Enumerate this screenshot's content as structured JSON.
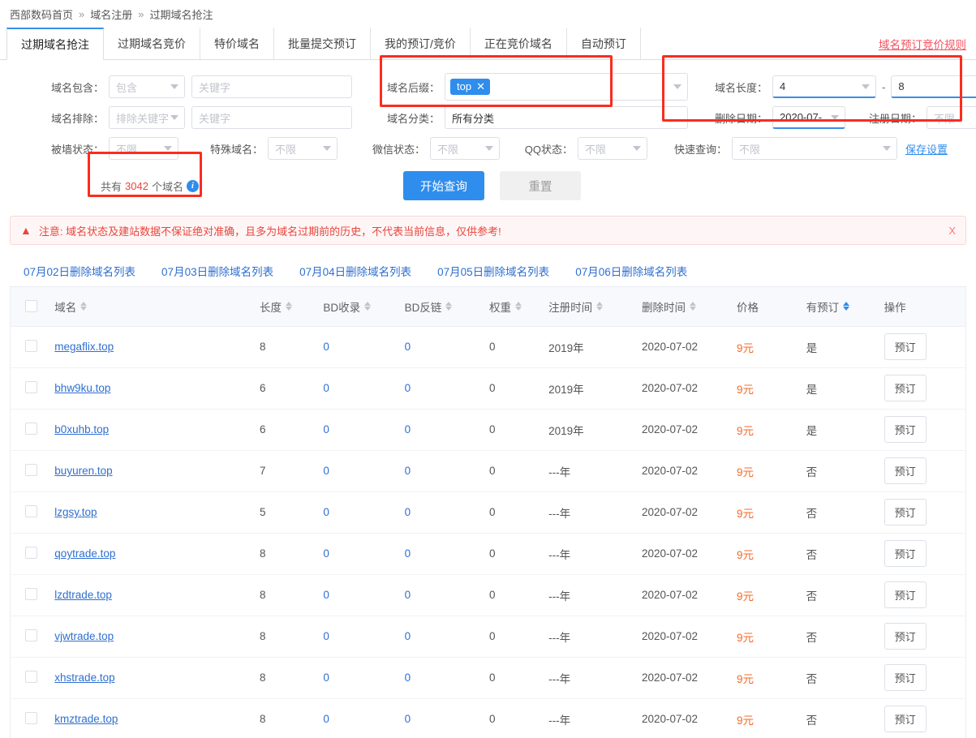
{
  "breadcrumb": {
    "items": [
      "西部数码首页",
      "域名注册",
      "过期域名抢注"
    ],
    "separator": "»"
  },
  "tabs": [
    {
      "label": "过期域名抢注",
      "active": true
    },
    {
      "label": "过期域名竞价",
      "active": false
    },
    {
      "label": "特价域名",
      "active": false
    },
    {
      "label": "批量提交预订",
      "active": false
    },
    {
      "label": "我的预订/竞价",
      "active": false
    },
    {
      "label": "正在竞价域名",
      "active": false
    },
    {
      "label": "自动预订",
      "active": false
    }
  ],
  "rules_link": "域名预订竞价规则",
  "filters": {
    "domain_contains": {
      "label": "域名包含：",
      "mode": "包含",
      "keyword_placeholder": "关键字",
      "keyword_value": ""
    },
    "domain_exclude": {
      "label": "域名排除：",
      "mode": "排除关键字",
      "keyword_placeholder": "关键字",
      "keyword_value": ""
    },
    "blocked_status": {
      "label": "被墙状态：",
      "value": "不限"
    },
    "special_domain": {
      "label": "特殊域名：",
      "value": "不限"
    },
    "domain_suffix": {
      "label": "域名后缀：",
      "tag": "top",
      "tag_close": "✕"
    },
    "domain_category": {
      "label": "域名分类：",
      "value": "所有分类"
    },
    "wechat_status": {
      "label": "微信状态：",
      "value": "不限"
    },
    "qq_status": {
      "label": "QQ状态：",
      "value": "不限"
    },
    "domain_length": {
      "label": "域名长度：",
      "from": "4",
      "separator": "-",
      "to": "8"
    },
    "delete_date": {
      "label": "删除日期：",
      "value": "2020-07-"
    },
    "register_date": {
      "label": "注册日期：",
      "value": "不限"
    },
    "quick_query": {
      "label": "快速查询：",
      "value": "不限"
    },
    "save_settings": "保存设置"
  },
  "summary": {
    "prefix": "共有",
    "count": "3042",
    "suffix": "个域名",
    "info_icon": "i"
  },
  "actions": {
    "search": "开始查询",
    "reset": "重置"
  },
  "notice": {
    "icon": "warning-icon",
    "text": "注意: 域名状态及建站数据不保证绝对准确，且多为域名过期前的历史，不代表当前信息，仅供参考!",
    "close": "X"
  },
  "date_links": [
    "07月02日删除域名列表",
    "07月03日删除域名列表",
    "07月04日删除域名列表",
    "07月05日删除域名列表",
    "07月06日删除域名列表"
  ],
  "table": {
    "columns": [
      {
        "key": "checkbox",
        "label": "",
        "sortable": false
      },
      {
        "key": "domain",
        "label": "域名",
        "sortable": true,
        "sort_active": false
      },
      {
        "key": "length",
        "label": "长度",
        "sortable": true,
        "sort_active": false
      },
      {
        "key": "bd_index",
        "label": "BD收录",
        "sortable": true,
        "sort_active": false
      },
      {
        "key": "bd_backlink",
        "label": "BD反链",
        "sortable": true,
        "sort_active": false
      },
      {
        "key": "weight",
        "label": "权重",
        "sortable": true,
        "sort_active": false
      },
      {
        "key": "reg_time",
        "label": "注册时间",
        "sortable": true,
        "sort_active": false
      },
      {
        "key": "del_time",
        "label": "删除时间",
        "sortable": true,
        "sort_active": false
      },
      {
        "key": "price",
        "label": "价格",
        "sortable": false,
        "sort_active": false
      },
      {
        "key": "booked",
        "label": "有预订",
        "sortable": true,
        "sort_active": true
      },
      {
        "key": "action",
        "label": "操作",
        "sortable": false
      }
    ],
    "book_button": "预订",
    "rows": [
      {
        "domain": "megaflix.top",
        "length": "8",
        "bd_index": "0",
        "bd_backlink": "0",
        "weight": "0",
        "reg_time": "2019年",
        "del_time": "2020-07-02",
        "price": "9元",
        "booked": "是"
      },
      {
        "domain": "bhw9ku.top",
        "length": "6",
        "bd_index": "0",
        "bd_backlink": "0",
        "weight": "0",
        "reg_time": "2019年",
        "del_time": "2020-07-02",
        "price": "9元",
        "booked": "是"
      },
      {
        "domain": "b0xuhb.top",
        "length": "6",
        "bd_index": "0",
        "bd_backlink": "0",
        "weight": "0",
        "reg_time": "2019年",
        "del_time": "2020-07-02",
        "price": "9元",
        "booked": "是"
      },
      {
        "domain": "buyuren.top",
        "length": "7",
        "bd_index": "0",
        "bd_backlink": "0",
        "weight": "0",
        "reg_time": "---年",
        "del_time": "2020-07-02",
        "price": "9元",
        "booked": "否"
      },
      {
        "domain": "lzgsy.top",
        "length": "5",
        "bd_index": "0",
        "bd_backlink": "0",
        "weight": "0",
        "reg_time": "---年",
        "del_time": "2020-07-02",
        "price": "9元",
        "booked": "否"
      },
      {
        "domain": "qoytrade.top",
        "length": "8",
        "bd_index": "0",
        "bd_backlink": "0",
        "weight": "0",
        "reg_time": "---年",
        "del_time": "2020-07-02",
        "price": "9元",
        "booked": "否"
      },
      {
        "domain": "lzdtrade.top",
        "length": "8",
        "bd_index": "0",
        "bd_backlink": "0",
        "weight": "0",
        "reg_time": "---年",
        "del_time": "2020-07-02",
        "price": "9元",
        "booked": "否"
      },
      {
        "domain": "vjwtrade.top",
        "length": "8",
        "bd_index": "0",
        "bd_backlink": "0",
        "weight": "0",
        "reg_time": "---年",
        "del_time": "2020-07-02",
        "price": "9元",
        "booked": "否"
      },
      {
        "domain": "xhstrade.top",
        "length": "8",
        "bd_index": "0",
        "bd_backlink": "0",
        "weight": "0",
        "reg_time": "---年",
        "del_time": "2020-07-02",
        "price": "9元",
        "booked": "否"
      },
      {
        "domain": "kmztrade.top",
        "length": "8",
        "bd_index": "0",
        "bd_backlink": "0",
        "weight": "0",
        "reg_time": "---年",
        "del_time": "2020-07-02",
        "price": "9元",
        "booked": "否"
      }
    ]
  },
  "colors": {
    "accent": "#2f8ded",
    "link": "#2f6fd0",
    "danger": "#e8453c",
    "price": "#f56a29",
    "annotation": "#fb2c1f"
  }
}
